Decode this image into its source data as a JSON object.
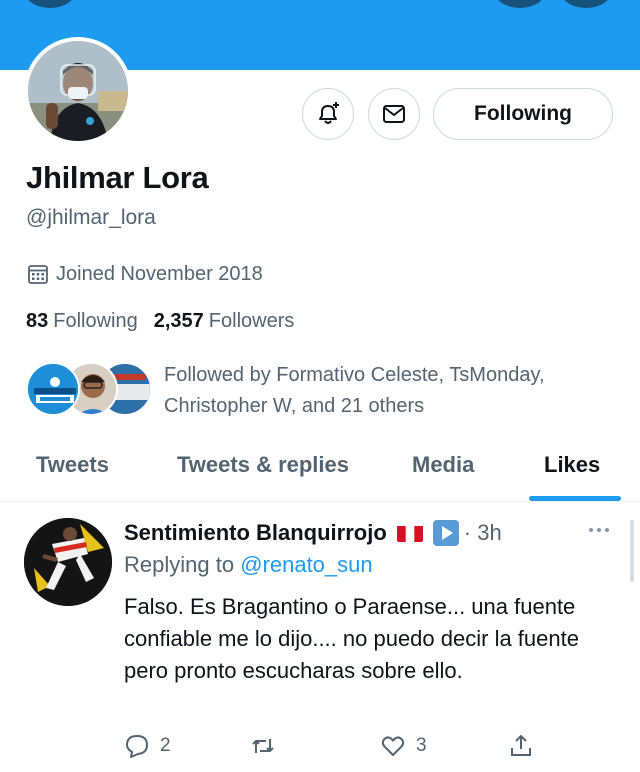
{
  "profile": {
    "name": "Jhilmar Lora",
    "handle": "@jhilmar_lora",
    "joined": "Joined November 2018",
    "following_count": "83",
    "following_label": "Following",
    "followers_count": "2,357",
    "followers_label": "Followers",
    "followed_by": "Followed by Formativo Celeste, TsMonday, Christopher W, and 21 others",
    "follow_button": "Following"
  },
  "tabs": [
    {
      "label": "Tweets",
      "active": false
    },
    {
      "label": "Tweets & replies",
      "active": false
    },
    {
      "label": "Media",
      "active": false
    },
    {
      "label": "Likes",
      "active": true
    }
  ],
  "tweet": {
    "author": "Sentimiento Blanquirrojo",
    "time": "· 3h",
    "reply_prefix": "Replying to",
    "reply_to": "@renato_sun",
    "text": "Falso. Es Bragantino o Paraense... una fuente confiable me lo dijo.... no puedo decir la fuente pero pronto escucharas sobre ello.",
    "replies": "2",
    "likes": "3"
  },
  "colors": {
    "accent": "#1d9bf0",
    "text": "#0f1419",
    "muted": "#536471",
    "border": "#cfd9de"
  },
  "icons": [
    "notification-bell-icon",
    "message-icon",
    "calendar-icon",
    "reply-icon",
    "retweet-icon",
    "like-icon",
    "share-icon",
    "more-icon",
    "peru-flag-icon",
    "play-icon"
  ]
}
